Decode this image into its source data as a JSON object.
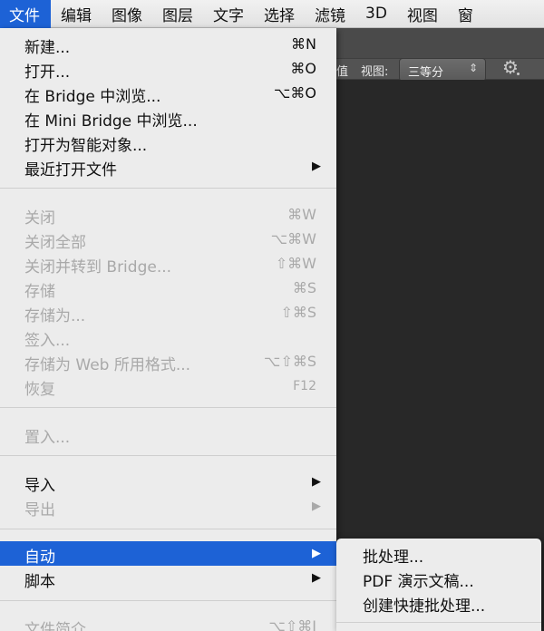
{
  "menubar": {
    "items": [
      {
        "label": "文件",
        "active": true
      },
      {
        "label": "编辑"
      },
      {
        "label": "图像"
      },
      {
        "label": "图层"
      },
      {
        "label": "文字"
      },
      {
        "label": "选择"
      },
      {
        "label": "滤镜"
      },
      {
        "label": "3D"
      },
      {
        "label": "视图"
      },
      {
        "label": "窗"
      }
    ]
  },
  "options_bar": {
    "cut_text": "值",
    "view_label": "视图:",
    "view_select_value": "三等分",
    "stepper_icon": "up-down-chevrons",
    "settings_icon": "gear-icon"
  },
  "file_menu": {
    "items": [
      {
        "label": "新建...",
        "shortcut": "⌘N",
        "enabled": true
      },
      {
        "label": "打开...",
        "shortcut": "⌘O",
        "enabled": true
      },
      {
        "label": "在 Bridge 中浏览...",
        "shortcut": "⌥⌘O",
        "enabled": true
      },
      {
        "label": "在 Mini Bridge 中浏览...",
        "shortcut": "",
        "enabled": true
      },
      {
        "label": "打开为智能对象...",
        "shortcut": "",
        "enabled": true
      },
      {
        "label": "最近打开文件",
        "shortcut": "",
        "submenu": true,
        "enabled": true
      },
      {
        "label": "关闭",
        "shortcut": "⌘W",
        "enabled": false
      },
      {
        "label": "关闭全部",
        "shortcut": "⌥⌘W",
        "enabled": false
      },
      {
        "label": "关闭并转到 Bridge...",
        "shortcut": "⇧⌘W",
        "enabled": false
      },
      {
        "label": "存储",
        "shortcut": "⌘S",
        "enabled": false
      },
      {
        "label": "存储为...",
        "shortcut": "⇧⌘S",
        "enabled": false
      },
      {
        "label": "签入...",
        "shortcut": "",
        "enabled": false
      },
      {
        "label": "存储为 Web 所用格式...",
        "shortcut": "⌥⇧⌘S",
        "enabled": false
      },
      {
        "label": "恢复",
        "shortcut": "F12",
        "enabled": false
      },
      {
        "label": "置入...",
        "shortcut": "",
        "enabled": false
      },
      {
        "label": "导入",
        "shortcut": "",
        "submenu": true,
        "enabled": true
      },
      {
        "label": "导出",
        "shortcut": "",
        "submenu": true,
        "enabled": false
      },
      {
        "label": "自动",
        "shortcut": "",
        "submenu": true,
        "enabled": true,
        "highlighted": true
      },
      {
        "label": "脚本",
        "shortcut": "",
        "submenu": true,
        "enabled": true
      },
      {
        "label": "文件简介...",
        "shortcut": "⌥⇧⌘I",
        "enabled": false
      }
    ],
    "arrow_glyph": "▶"
  },
  "automate_submenu": {
    "items": [
      {
        "label": "批处理..."
      },
      {
        "label": "PDF 演示文稿..."
      },
      {
        "label": "创建快捷批处理..."
      }
    ]
  },
  "colors": {
    "highlight": "#1d62d6",
    "menu_bg": "#ececec",
    "disabled_text": "#a9a9a9",
    "workspace": "#282828"
  }
}
